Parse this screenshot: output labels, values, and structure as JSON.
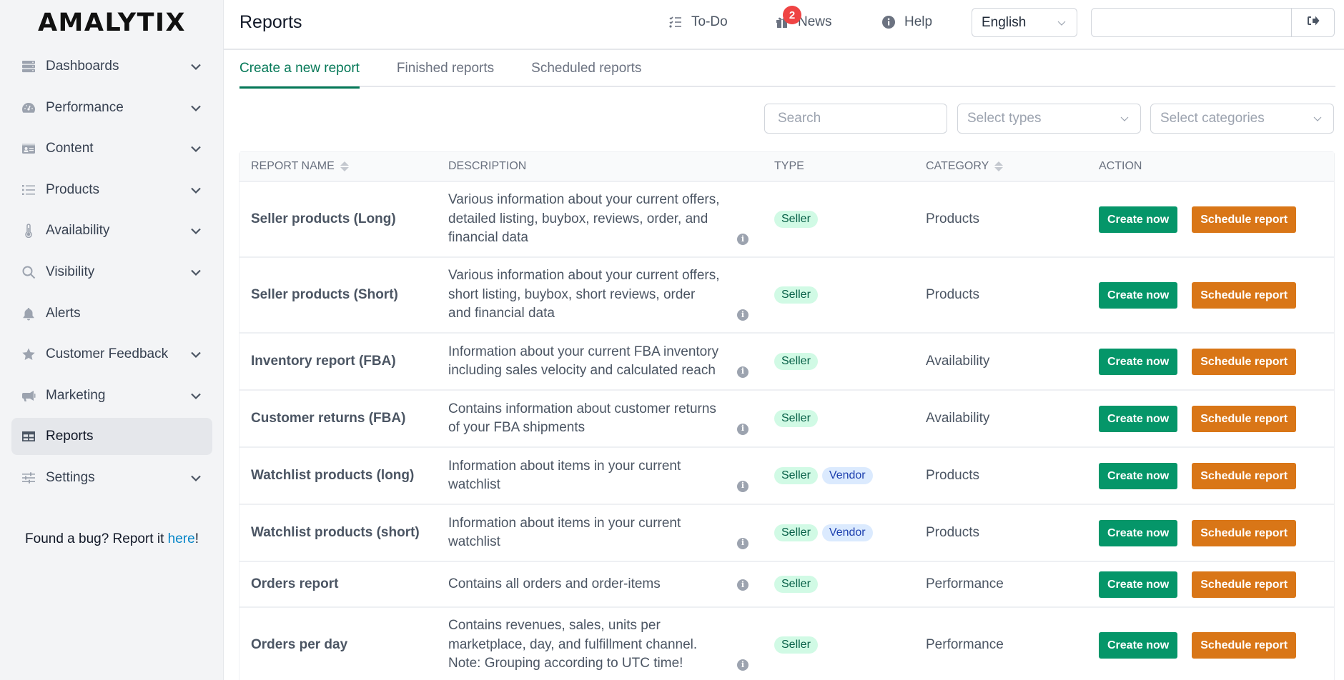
{
  "sidebar": {
    "logo": "AMALYTIX",
    "items": [
      {
        "label": "Dashboards",
        "icon": "server-icon",
        "expandable": true,
        "active": false
      },
      {
        "label": "Performance",
        "icon": "gauge-icon",
        "expandable": true,
        "active": false
      },
      {
        "label": "Content",
        "icon": "id-card-icon",
        "expandable": true,
        "active": false
      },
      {
        "label": "Products",
        "icon": "list-icon",
        "expandable": true,
        "active": false
      },
      {
        "label": "Availability",
        "icon": "thermometer-icon",
        "expandable": true,
        "active": false
      },
      {
        "label": "Visibility",
        "icon": "search-icon",
        "expandable": true,
        "active": false
      },
      {
        "label": "Alerts",
        "icon": "bell-icon",
        "expandable": false,
        "active": false
      },
      {
        "label": "Customer Feedback",
        "icon": "star-icon",
        "expandable": true,
        "active": false
      },
      {
        "label": "Marketing",
        "icon": "megaphone-icon",
        "expandable": true,
        "active": false
      },
      {
        "label": "Reports",
        "icon": "table-icon",
        "expandable": false,
        "active": true
      },
      {
        "label": "Settings",
        "icon": "sliders-icon",
        "expandable": true,
        "active": false
      }
    ],
    "bug_text": "Found a bug? Report it ",
    "bug_link": "here",
    "bug_suffix": "!"
  },
  "header": {
    "title": "Reports",
    "todo_label": "To-Do",
    "news_label": "News",
    "news_count": "2",
    "help_label": "Help",
    "language": "English",
    "login_value": ""
  },
  "tabs": [
    {
      "label": "Create a new report",
      "active": true
    },
    {
      "label": "Finished reports",
      "active": false
    },
    {
      "label": "Scheduled reports",
      "active": false
    }
  ],
  "filters": {
    "search_placeholder": "Search",
    "types_placeholder": "Select types",
    "categories_placeholder": "Select categories"
  },
  "table": {
    "columns": [
      "Report name",
      "Description",
      "Type",
      "Category",
      "Action"
    ],
    "create_label": "Create now",
    "schedule_label": "Schedule report",
    "rows": [
      {
        "name": "Seller products (Long)",
        "description": "Various information about your current offers, detailed listing, buybox, reviews, order, and financial data",
        "types": [
          "Seller"
        ],
        "category": "Products"
      },
      {
        "name": "Seller products (Short)",
        "description": "Various information about your current offers, short listing, buybox, short reviews, order and financial data",
        "types": [
          "Seller"
        ],
        "category": "Products"
      },
      {
        "name": "Inventory report (FBA)",
        "description": "Information about your current FBA inventory including sales velocity and calculated reach",
        "types": [
          "Seller"
        ],
        "category": "Availability"
      },
      {
        "name": "Customer returns (FBA)",
        "description": "Contains information about customer returns of your FBA shipments",
        "types": [
          "Seller"
        ],
        "category": "Availability"
      },
      {
        "name": "Watchlist products (long)",
        "description": "Information about items in your current watchlist",
        "types": [
          "Seller",
          "Vendor"
        ],
        "category": "Products"
      },
      {
        "name": "Watchlist products (short)",
        "description": "Information about items in your current watchlist",
        "types": [
          "Seller",
          "Vendor"
        ],
        "category": "Products"
      },
      {
        "name": "Orders report",
        "description": "Contains all orders and order-items",
        "types": [
          "Seller"
        ],
        "category": "Performance"
      },
      {
        "name": "Orders per day",
        "description": "Contains revenues, sales, units per marketplace, day, and fulfillment channel. Note: Grouping according to UTC time!",
        "types": [
          "Seller"
        ],
        "category": "Performance"
      }
    ]
  },
  "colors": {
    "accent_green": "#059669",
    "tab_active": "#047857",
    "schedule_orange": "#d97617",
    "badge_red": "#ef4444",
    "link_blue": "#0284c7"
  }
}
